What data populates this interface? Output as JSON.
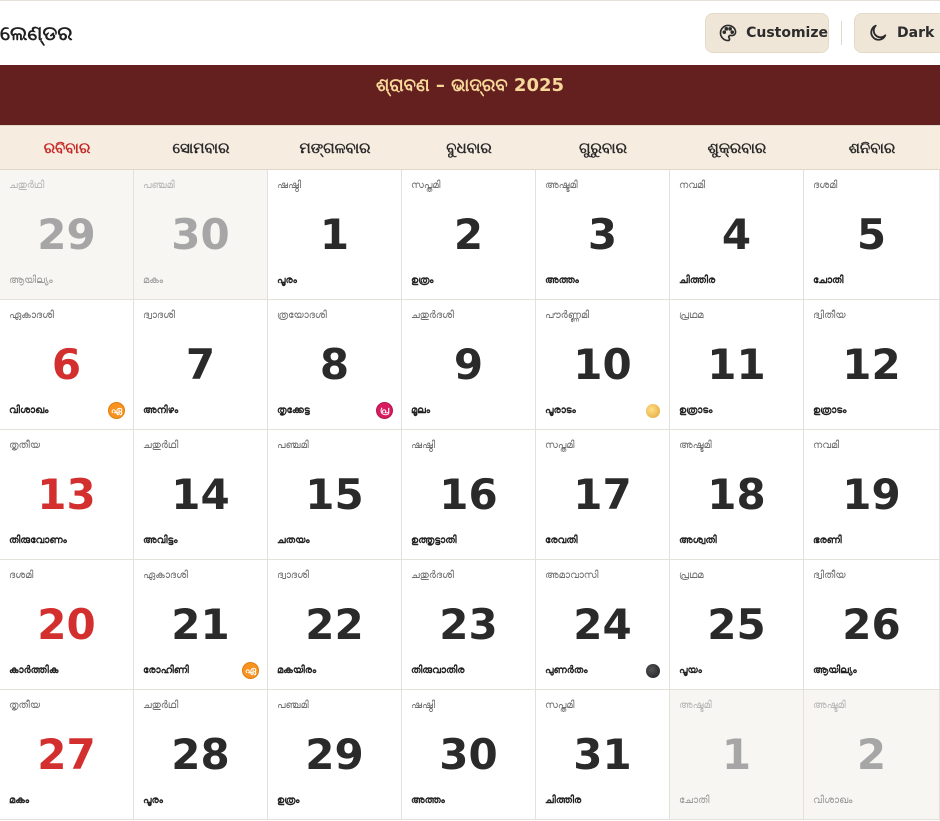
{
  "app": {
    "title": "ଲେଣ୍ଡର"
  },
  "toolbar": {
    "customize_label": "Customize",
    "customize_icon": "palette-icon",
    "dark_label": "Dark",
    "dark_icon": "moon-icon"
  },
  "banner": {
    "month_title": "ଶ୍ରାବଣ – ଭାଦ୍ରବ 2025"
  },
  "colors": {
    "banner": "#641f1f",
    "banner_text": "#f6d89a",
    "sunday": "#d32f2f",
    "header_bg": "#f6ece0",
    "button_bg": "#efe6d8"
  },
  "weekdays": [
    "ରବିବାର",
    "ସୋମବାର",
    "ମଙ୍ଗଳବାର",
    "ବୁଧବାର",
    "ଗୁରୁବାର",
    "ଶୁକ୍ରବାର",
    "ଶନିବାର"
  ],
  "weeks": [
    [
      {
        "day": "29",
        "tithi": "ചതുർഥി",
        "star": "ആയില്യം",
        "other": true
      },
      {
        "day": "30",
        "tithi": "പഞ്ചമി",
        "star": "മകം",
        "other": true
      },
      {
        "day": "1",
        "tithi": "ഷഷ്ഠി",
        "star": "പൂരം"
      },
      {
        "day": "2",
        "tithi": "സപ്തമി",
        "star": "ഉത്രം"
      },
      {
        "day": "3",
        "tithi": "അഷ്ടമി",
        "star": "അത്തം"
      },
      {
        "day": "4",
        "tithi": "നവമി",
        "star": "ചിത്തിര"
      },
      {
        "day": "5",
        "tithi": "ദശമി",
        "star": "ചോതി"
      }
    ],
    [
      {
        "day": "6",
        "tithi": "ഏകാദശി",
        "star": "വിശാഖം",
        "badge": "ഏ",
        "badge_color": "orange"
      },
      {
        "day": "7",
        "tithi": "ദ്വാദശി",
        "star": "അനിഴം"
      },
      {
        "day": "8",
        "tithi": "ത്രയോദശി",
        "star": "തൃക്കേട്ട",
        "badge": "പ്ര",
        "badge_color": "pink"
      },
      {
        "day": "9",
        "tithi": "ചതുർദശി",
        "star": "മൂലം"
      },
      {
        "day": "10",
        "tithi": "പൗർണ്ണമി",
        "star": "പൂരാടം",
        "moon": "full"
      },
      {
        "day": "11",
        "tithi": "പ്രഥമ",
        "star": "ഉത്രാടം"
      },
      {
        "day": "12",
        "tithi": "ദ്വിതീയ",
        "star": "ഉത്രാടം"
      }
    ],
    [
      {
        "day": "13",
        "tithi": "തൃതീയ",
        "star": "തിരുവോണം"
      },
      {
        "day": "14",
        "tithi": "ചതുർഥി",
        "star": "അവിട്ടം"
      },
      {
        "day": "15",
        "tithi": "പഞ്ചമി",
        "star": "ചതയം"
      },
      {
        "day": "16",
        "tithi": "ഷഷ്ഠി",
        "star": "ഉത്തൃട്ടാതി"
      },
      {
        "day": "17",
        "tithi": "സപ്തമി",
        "star": "രേവതി"
      },
      {
        "day": "18",
        "tithi": "അഷ്ടമി",
        "star": "അശ്വതി"
      },
      {
        "day": "19",
        "tithi": "നവമി",
        "star": "ഭരണി"
      }
    ],
    [
      {
        "day": "20",
        "tithi": "ദശമി",
        "star": "കാർത്തിക"
      },
      {
        "day": "21",
        "tithi": "ഏകാദശി",
        "star": "രോഹിണി",
        "badge": "ഏ",
        "badge_color": "orange"
      },
      {
        "day": "22",
        "tithi": "ദ്വാദശി",
        "star": "മകയിരം"
      },
      {
        "day": "23",
        "tithi": "ചതുർദശി",
        "star": "തിരുവാതിര"
      },
      {
        "day": "24",
        "tithi": "അമാവാസി",
        "star": "പുണർതം",
        "moon": "new"
      },
      {
        "day": "25",
        "tithi": "പ്രഥമ",
        "star": "പൂയം"
      },
      {
        "day": "26",
        "tithi": "ദ്വിതീയ",
        "star": "ആയില്യം"
      }
    ],
    [
      {
        "day": "27",
        "tithi": "തൃതീയ",
        "star": "മകം"
      },
      {
        "day": "28",
        "tithi": "ചതുർഥി",
        "star": "പൂരം"
      },
      {
        "day": "29",
        "tithi": "പഞ്ചമി",
        "star": "ഉത്രം"
      },
      {
        "day": "30",
        "tithi": "ഷഷ്ഠി",
        "star": "അത്തം"
      },
      {
        "day": "31",
        "tithi": "സപ്തമി",
        "star": "ചിത്തിര"
      },
      {
        "day": "1",
        "tithi": "അഷ്ടമി",
        "star": "ചോതി",
        "other": true
      },
      {
        "day": "2",
        "tithi": "അഷ്ടമി",
        "star": "വിശാഖം",
        "other": true
      }
    ]
  ]
}
